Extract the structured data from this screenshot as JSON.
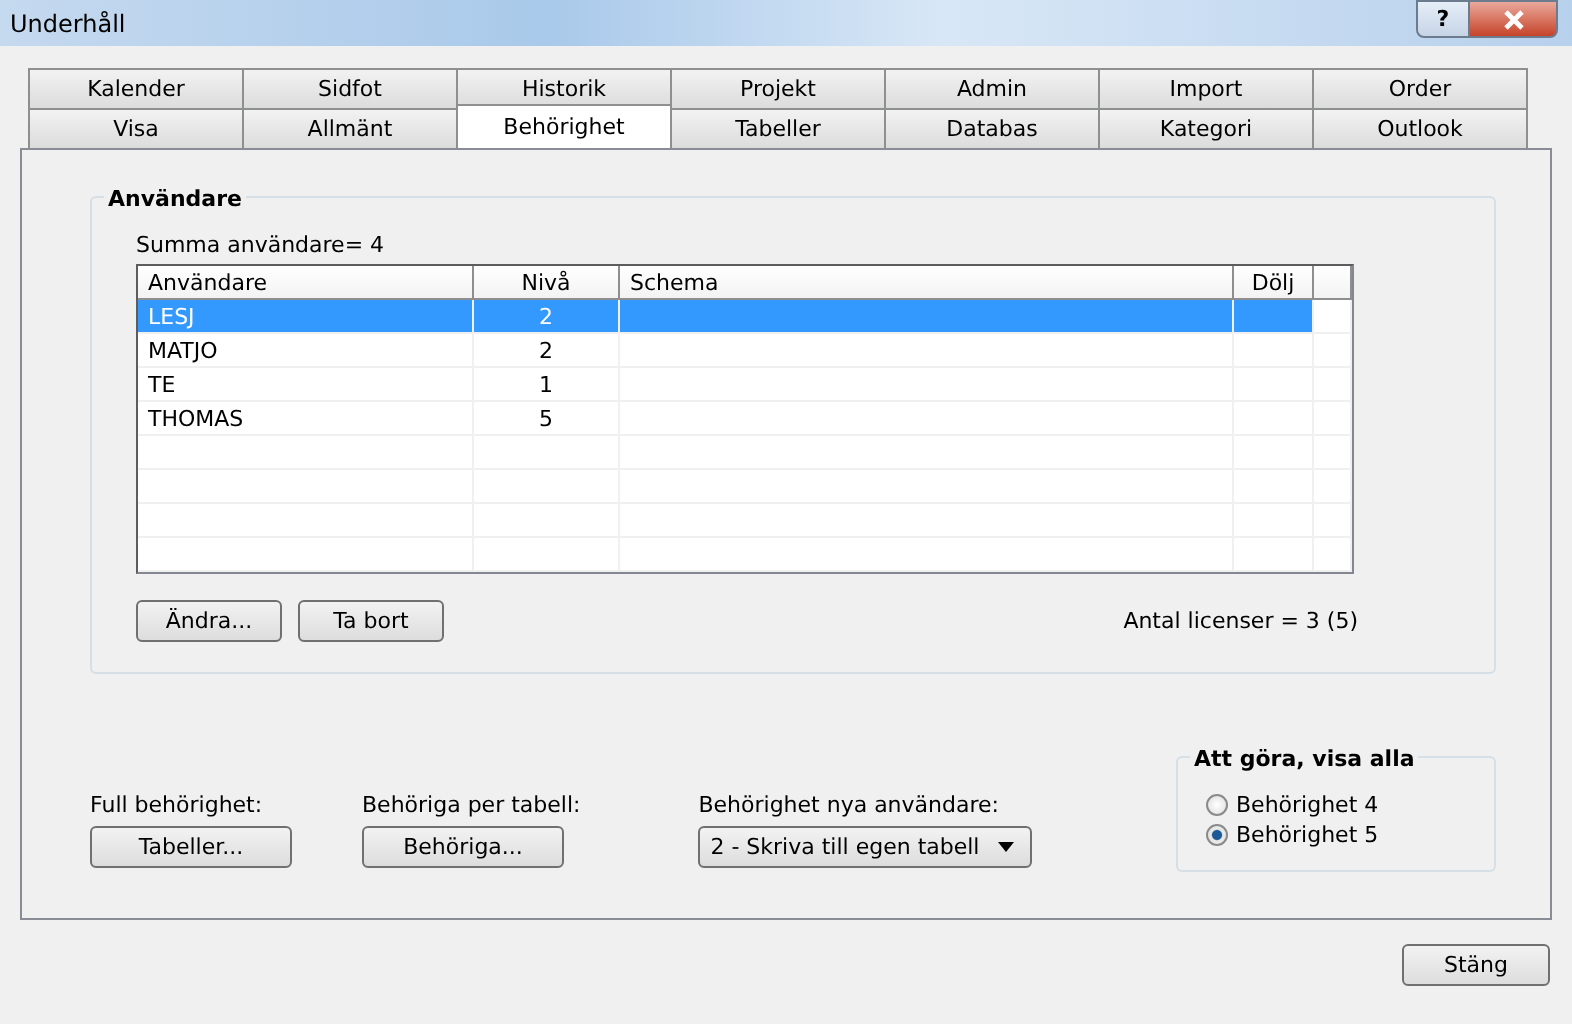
{
  "window": {
    "title": "Underhåll",
    "help_button": "?"
  },
  "tab_rows": [
    [
      {
        "label": "Kalender",
        "selected": false
      },
      {
        "label": "Sidfot",
        "selected": false
      },
      {
        "label": "Historik",
        "selected": false
      },
      {
        "label": "Projekt",
        "selected": false
      },
      {
        "label": "Admin",
        "selected": false
      },
      {
        "label": "Import",
        "selected": false
      },
      {
        "label": "Order",
        "selected": false
      }
    ],
    [
      {
        "label": "Visa",
        "selected": false
      },
      {
        "label": "Allmänt",
        "selected": false
      },
      {
        "label": "Behörighet",
        "selected": true
      },
      {
        "label": "Tabeller",
        "selected": false
      },
      {
        "label": "Databas",
        "selected": false
      },
      {
        "label": "Kategori",
        "selected": false
      },
      {
        "label": "Outlook",
        "selected": false
      }
    ]
  ],
  "users_group": {
    "title": "Användare",
    "summary": "Summa användare= 4",
    "table": {
      "columns": [
        "Användare",
        "Nivå",
        "Schema",
        "Dölj"
      ],
      "rows": [
        {
          "user": "LESJ",
          "level": "2",
          "selected": true
        },
        {
          "user": "MATJO",
          "level": "2",
          "selected": false
        },
        {
          "user": "TE",
          "level": "1",
          "selected": false
        },
        {
          "user": "THOMAS",
          "level": "5",
          "selected": false
        }
      ]
    },
    "buttons": [
      "Ändra...",
      "Ta bort"
    ],
    "licenses": "Antal licenser = 3 (5)"
  },
  "full_permission": {
    "label": "Full behörighet:",
    "button": "Tabeller..."
  },
  "per_table": {
    "label": "Behöriga per tabell:",
    "button": "Behöriga..."
  },
  "new_users": {
    "label": "Behörighet nya användare:",
    "value": "2 - Skriva till egen tabell"
  },
  "todo_group": {
    "title": "Att göra, visa alla",
    "options": [
      {
        "label": "Behörighet 4",
        "selected": false
      },
      {
        "label": "Behörighet 5",
        "selected": true
      }
    ]
  },
  "close_button": "Stäng"
}
